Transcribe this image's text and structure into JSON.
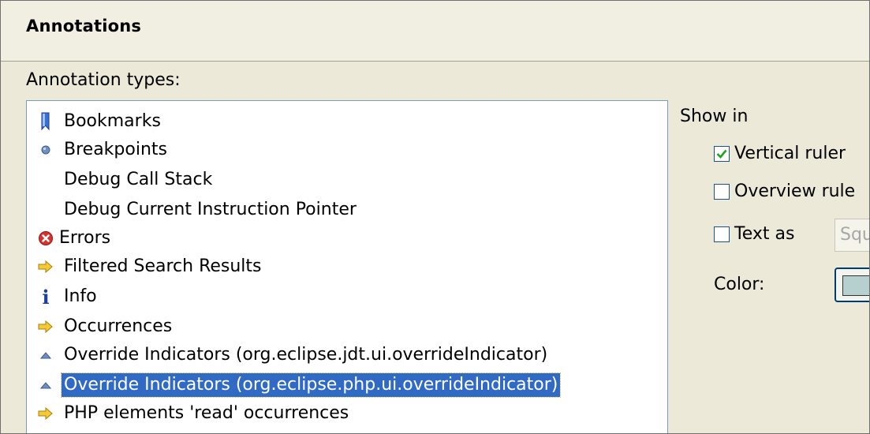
{
  "section": {
    "title": "Annotations"
  },
  "annotation_types": {
    "label": "Annotation types:",
    "items": [
      {
        "label": "Bookmarks",
        "icon": "bookmark-icon"
      },
      {
        "label": "Breakpoints",
        "icon": "breakpoint-icon"
      },
      {
        "label": "Debug Call Stack",
        "icon": ""
      },
      {
        "label": "Debug Current Instruction Pointer",
        "icon": ""
      },
      {
        "label": "Errors",
        "icon": "error-icon"
      },
      {
        "label": "Filtered Search Results",
        "icon": "arrow-right-icon"
      },
      {
        "label": "Info",
        "icon": "info-icon"
      },
      {
        "label": "Occurrences",
        "icon": "arrow-right-icon"
      },
      {
        "label": "Override Indicators (org.eclipse.jdt.ui.overrideIndicator)",
        "icon": "override-triangle-icon"
      },
      {
        "label": "Override Indicators (org.eclipse.php.ui.overrideIndicator)",
        "icon": "override-triangle-icon",
        "selected": true
      },
      {
        "label": "PHP elements 'read' occurrences",
        "icon": "arrow-right-icon"
      }
    ]
  },
  "show_in": {
    "label": "Show in",
    "vertical_ruler": {
      "label": "Vertical ruler",
      "checked": true
    },
    "overview_ruler": {
      "label": "Overview rule",
      "checked": false
    },
    "text_as": {
      "label": "Text as",
      "checked": false,
      "value": "Squ"
    },
    "color": {
      "label": "Color:",
      "value": "#b5d0cf"
    }
  },
  "colors": {
    "selection": "#316ac5",
    "window_bg": "#ece9d8",
    "error": "#d9322c",
    "arrow": "#e8a400"
  }
}
